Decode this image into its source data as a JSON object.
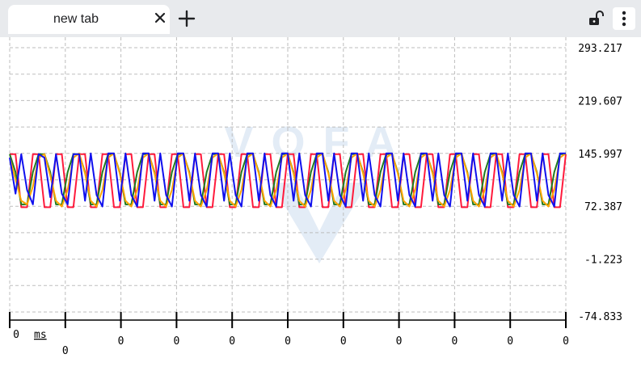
{
  "tab": {
    "title": "new tab",
    "close_icon": "close-icon",
    "new_tab_icon": "plus-icon"
  },
  "toolbar": {
    "lock_icon": "unlocked-padlock-icon",
    "menu_icon": "vertical-dots-menu-icon"
  },
  "watermark": "VOFA",
  "chart_data": {
    "type": "line",
    "yticks": [
      "293.217",
      "219.607",
      "145.997",
      "72.387",
      "-1.223",
      "-74.833"
    ],
    "ylim": [
      -74.833,
      293.217
    ],
    "xticks": [
      "0",
      "0",
      "0",
      "0",
      "0",
      "0",
      "0",
      "0",
      "0",
      "0",
      "0"
    ],
    "x_unit": "ms",
    "grid": true,
    "colors": {
      "grid": "#bdbdbd",
      "axis": "#000000"
    },
    "series": [
      {
        "color": "#ff1a3c",
        "values": [
          145,
          145,
          71,
          71,
          145,
          145,
          71,
          71,
          145,
          145,
          71,
          71,
          145,
          145,
          71,
          71,
          145,
          145,
          71,
          71,
          145,
          145,
          71,
          71,
          145,
          145,
          71,
          71,
          145,
          145,
          71,
          71,
          145,
          145,
          71,
          71,
          145,
          145,
          71,
          71,
          145,
          145,
          71,
          71,
          145,
          145,
          71,
          71,
          145,
          145,
          71,
          71,
          145,
          145,
          71,
          71,
          145,
          145,
          71,
          71,
          145,
          145,
          71,
          71,
          145,
          145,
          71,
          71,
          145,
          145,
          71,
          71,
          145,
          145,
          71,
          71,
          145,
          145,
          71,
          71,
          145,
          145,
          71,
          71,
          145,
          145,
          71,
          71,
          145,
          145,
          71,
          71,
          145,
          145,
          71,
          71,
          145
        ]
      },
      {
        "color": "#1f7a1f",
        "values": [
          145,
          120,
          75,
          75,
          120,
          145,
          145,
          120,
          75,
          75,
          120,
          145,
          145,
          120,
          75,
          75,
          120,
          145,
          145,
          120,
          75,
          75,
          120,
          145,
          145,
          120,
          75,
          75,
          120,
          145,
          145,
          120,
          75,
          75,
          120,
          145,
          145,
          120,
          75,
          75,
          120,
          145,
          145,
          120,
          75,
          75,
          120,
          145,
          145,
          120,
          75,
          75,
          120,
          145,
          145,
          120,
          75,
          75,
          120,
          145,
          145,
          120,
          75,
          75,
          120,
          145,
          145,
          120,
          75,
          75,
          120,
          145,
          145,
          120,
          75,
          75,
          120,
          145,
          145,
          120,
          75,
          75,
          120,
          145,
          145,
          120,
          75,
          75,
          120,
          145,
          145,
          120,
          75,
          75,
          120,
          145,
          145
        ]
      },
      {
        "color": "#ffa500",
        "values": [
          140,
          110,
          80,
          75,
          100,
          140,
          145,
          115,
          80,
          72,
          95,
          140,
          146,
          118,
          80,
          72,
          95,
          140,
          146,
          118,
          80,
          72,
          95,
          140,
          146,
          118,
          80,
          72,
          95,
          140,
          146,
          118,
          80,
          72,
          95,
          140,
          146,
          118,
          80,
          72,
          95,
          140,
          146,
          118,
          80,
          72,
          95,
          140,
          146,
          118,
          80,
          72,
          95,
          140,
          146,
          118,
          80,
          72,
          95,
          140,
          146,
          118,
          80,
          72,
          95,
          140,
          146,
          118,
          80,
          72,
          95,
          140,
          146,
          118,
          80,
          72,
          95,
          140,
          146,
          118,
          80,
          72,
          95,
          140,
          146,
          118,
          80,
          72,
          95,
          140,
          146,
          118,
          80,
          72,
          95,
          140,
          146
        ]
      },
      {
        "color": "#1010ee",
        "values": [
          140,
          90,
          145,
          95,
          75,
          145,
          140,
          85,
          145,
          90,
          75,
          145,
          145,
          80,
          146,
          88,
          72,
          146,
          146,
          80,
          146,
          88,
          72,
          146,
          146,
          80,
          146,
          88,
          72,
          146,
          146,
          80,
          146,
          88,
          72,
          146,
          146,
          80,
          146,
          88,
          72,
          146,
          146,
          80,
          146,
          88,
          72,
          146,
          146,
          80,
          146,
          88,
          72,
          146,
          146,
          80,
          146,
          88,
          72,
          146,
          146,
          80,
          146,
          88,
          72,
          146,
          146,
          80,
          146,
          88,
          72,
          146,
          146,
          80,
          146,
          88,
          72,
          146,
          146,
          80,
          146,
          88,
          72,
          146,
          146,
          80,
          146,
          88,
          72,
          146,
          146,
          80,
          146,
          88,
          72,
          146,
          146
        ]
      }
    ]
  }
}
